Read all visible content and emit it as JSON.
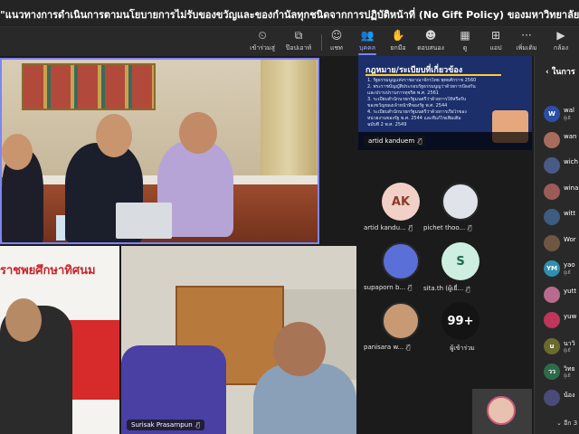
{
  "window": {
    "title": "\"แนวทางการดำเนินการตามนโยบายการไม่รับของขวัญและของกำนัลทุกชนิดจากการปฏิบัติหน้าที่ (No Gift Policy) ของมหาวิทยาลัยพะเยา และการส่งเสริมด้านคุณธรรม จริยธรรม ของบุคลากร"
  },
  "toolbar": {
    "items": [
      {
        "icon": "clock-icon",
        "glyph": "⏲",
        "label": "เข้าร่วมสู่"
      },
      {
        "icon": "screen-icon",
        "glyph": "⧉",
        "label": "ป๊อปเอาท์"
      },
      {
        "icon": "chat-icon",
        "glyph": "☺",
        "label": "แชท"
      },
      {
        "icon": "people-icon",
        "glyph": "👥",
        "label": "บุคคล"
      },
      {
        "icon": "hand-icon",
        "glyph": "✋",
        "label": "ยกมือ"
      },
      {
        "icon": "react-icon",
        "glyph": "☻",
        "label": "ตอบสนอง"
      },
      {
        "icon": "view-icon",
        "glyph": "▦",
        "label": "ดู"
      },
      {
        "icon": "apps-icon",
        "glyph": "⊞",
        "label": "แอป"
      },
      {
        "icon": "more-icon",
        "glyph": "···",
        "label": "เพิ่มเติม"
      },
      {
        "icon": "camera-off-icon",
        "glyph": "▶",
        "label": "กล้อง"
      }
    ],
    "active_index": 3
  },
  "tiles": {
    "artid_slide": {
      "slide_title": "กฎหมาย/ระเบียบที่เกี่ยวข้อง",
      "lines": [
        "1. รัฐธรรมนูญแห่งราชอาณาจักรไทย พุทธศักราช 2560",
        "2. พระราชบัญญัติประกอบรัฐธรรมนูญว่าด้วยการป้องกัน",
        "   และปราบปรามการทุจริต พ.ศ. 2561",
        "3. ระเบียบสำนักนายกรัฐมนตรีว่าด้วยการให้หรือรับ",
        "   ของขวัญของเจ้าหน้าที่ของรัฐ พ.ศ. 2544",
        "4. ระเบียบสำนักนายกรัฐมนตรีว่าด้วยการเรี่ยไรของ",
        "   หน่วยงานของรัฐ พ.ศ. 2544 และที่แก้ไขเพิ่มเติม",
        "   ฉบับที่ 2 พ.ศ. 2549"
      ],
      "name": "artid kanduem"
    },
    "bottom_right_name": "Surisak Prasarnpun",
    "bottom_left_banner": "ราชพยศึกษาทิศนม"
  },
  "participants": [
    {
      "initials": "AK",
      "name": "artid kandu...",
      "bg": "#f1d1c7",
      "fg": "#8a3b2b",
      "photo": false
    },
    {
      "initials": "",
      "name": "pichet thoo...",
      "bg": "#e0e4ea",
      "fg": "#333",
      "photo": true
    },
    {
      "initials": "",
      "name": "supaporn b...",
      "bg": "#5b6fd8",
      "fg": "#fff",
      "photo": true
    },
    {
      "initials": "S",
      "name": "sita.th (ผู้เยี่...",
      "bg": "#cdeee0",
      "fg": "#1d6b4b",
      "photo": false
    },
    {
      "initials": "",
      "name": "panisara w...",
      "bg": "#c89a74",
      "fg": "#fff",
      "photo": true
    },
    {
      "initials": "99+",
      "name": "ผู้เข้าร่วม",
      "bg": "#141414",
      "fg": "#fff",
      "photo": false
    }
  ],
  "panel": {
    "header": "ในการ",
    "items": [
      {
        "initials": "W",
        "name": "wal",
        "sub": "ผู้เยี่",
        "bg": "#2b4fa8"
      },
      {
        "initials": "",
        "name": "wan",
        "sub": "",
        "bg": "#a86c5c"
      },
      {
        "initials": "",
        "name": "wich",
        "sub": "",
        "bg": "#495a86"
      },
      {
        "initials": "",
        "name": "wina",
        "sub": "",
        "bg": "#9c5b58"
      },
      {
        "initials": "",
        "name": "witt",
        "sub": "",
        "bg": "#3c5c80"
      },
      {
        "initials": "",
        "name": "Wor",
        "sub": "",
        "bg": "#6f5642"
      },
      {
        "initials": "YM",
        "name": "yao",
        "sub": "ผู้เยี่",
        "bg": "#2f8fae"
      },
      {
        "initials": "",
        "name": "yutt",
        "sub": "",
        "bg": "#b86b8f"
      },
      {
        "initials": "",
        "name": "yuw",
        "sub": "",
        "bg": "#c0355a"
      },
      {
        "initials": "u",
        "name": "นาวิ",
        "sub": "ผู้เยี่",
        "bg": "#6c6a2d"
      },
      {
        "initials": "วว",
        "name": "วิทย",
        "sub": "ผู้เยี่",
        "bg": "#2e6b4a"
      },
      {
        "initials": "",
        "name": "น้อง",
        "sub": "",
        "bg": "#4b4b7a"
      }
    ],
    "more": "อีก 3"
  }
}
